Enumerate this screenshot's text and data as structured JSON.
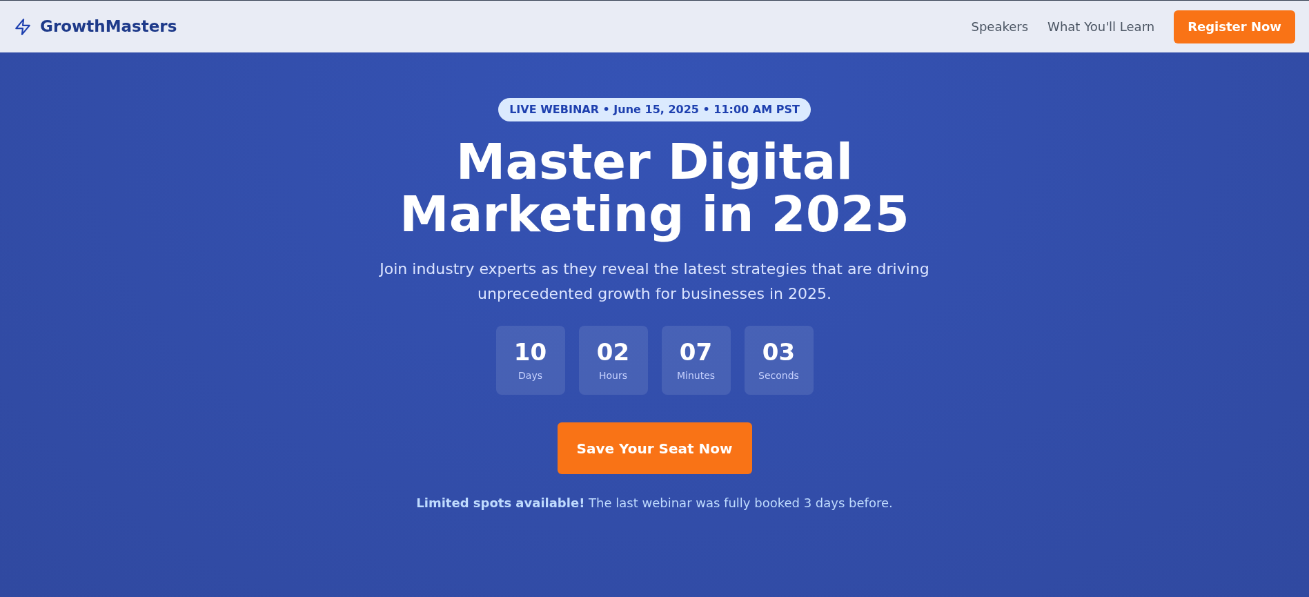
{
  "header": {
    "brand": "GrowthMasters",
    "nav": [
      "Speakers",
      "What You'll Learn"
    ],
    "cta": "Register Now"
  },
  "hero": {
    "badge": "LIVE WEBINAR • June 15, 2025 • 11:00 AM PST",
    "title": "Master Digital Marketing in 2025",
    "subtitle": "Join industry experts as they reveal the latest strategies that are driving unprecedented growth for businesses in 2025.",
    "countdown": [
      {
        "value": "10",
        "unit": "Days"
      },
      {
        "value": "02",
        "unit": "Hours"
      },
      {
        "value": "07",
        "unit": "Minutes"
      },
      {
        "value": "03",
        "unit": "Seconds"
      }
    ],
    "button": "Save Your Seat Now",
    "note": "**Limited spots available!** The last webinar was fully booked 3 days before."
  }
}
